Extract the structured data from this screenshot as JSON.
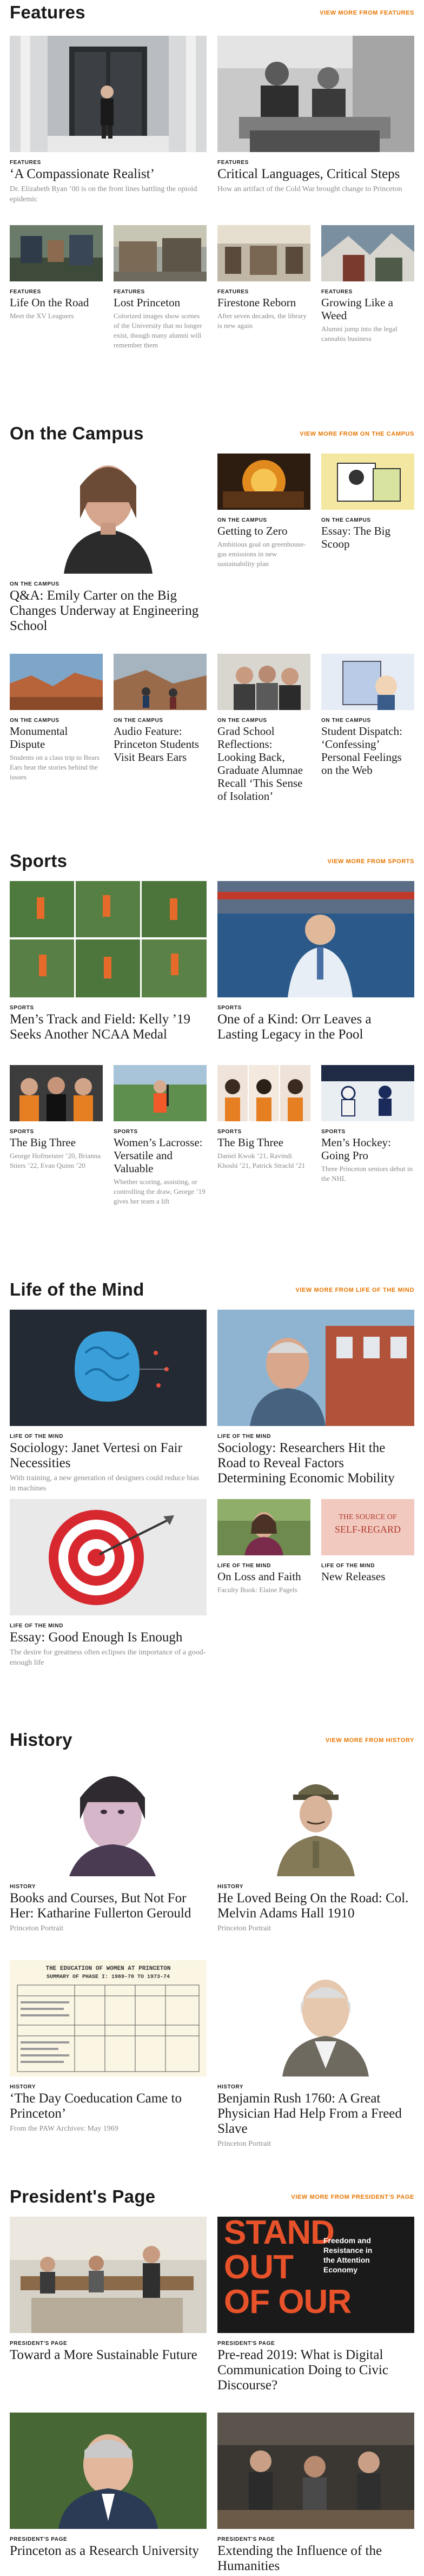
{
  "features": {
    "title": "Features",
    "view_more": "VIEW MORE FROM FEATURES",
    "cards": [
      {
        "kicker": "FEATURES",
        "title": "‘A Compassionate Realist’",
        "dek": "Dr. Elizabeth Ryan ’00 is on the front lines battling the opioid epidemic"
      },
      {
        "kicker": "FEATURES",
        "title": "Critical Languages, Critical Steps",
        "dek": "How an artifact of the Cold War brought change to Princeton"
      },
      {
        "kicker": "FEATURES",
        "title": "Life On the Road",
        "dek": "Meet the XV Leaguers"
      },
      {
        "kicker": "FEATURES",
        "title": "Lost Princeton",
        "dek": "Colorized images show scenes of the University that no longer exist, though many alumni will remember them"
      },
      {
        "kicker": "FEATURES",
        "title": "Firestone Reborn",
        "dek": "After seven decades, the library is new again"
      },
      {
        "kicker": "FEATURES",
        "title": "Growing Like a Weed",
        "dek": "Alumni jump into the legal cannabis business"
      }
    ]
  },
  "campus": {
    "title": "On the Campus",
    "view_more": "VIEW MORE FROM ON THE CAMPUS",
    "cards": [
      {
        "kicker": "ON THE CAMPUS",
        "title": "Q&A: Emily Carter on the Big Changes Underway at Engineering School",
        "dek": ""
      },
      {
        "kicker": "ON THE CAMPUS",
        "title": "Getting to Zero",
        "dek": "Ambitious goal on greenhouse-gas emissions in new sustainability plan"
      },
      {
        "kicker": "ON THE CAMPUS",
        "title": "Essay: The Big Scoop",
        "dek": ""
      },
      {
        "kicker": "ON THE CAMPUS",
        "title": "Monumental Dispute",
        "dek": "Students on a class trip to Bears Ears hear the stories behind the issues"
      },
      {
        "kicker": "ON THE CAMPUS",
        "title": "Audio Feature: Princeton Students Visit Bears Ears",
        "dek": ""
      },
      {
        "kicker": "ON THE CAMPUS",
        "title": "Grad School Reflections: Looking Back, Graduate Alumnae Recall ‘This Sense of Isolation’",
        "dek": ""
      },
      {
        "kicker": "ON THE CAMPUS",
        "title": "Student Dispatch: ‘Confessing’ Personal Feelings on the Web",
        "dek": ""
      }
    ]
  },
  "sports": {
    "title": "Sports",
    "view_more": "VIEW MORE FROM SPORTS",
    "cards": [
      {
        "kicker": "SPORTS",
        "title": "Men’s Track and Field: Kelly ’19 Seeks Another NCAA Medal",
        "dek": ""
      },
      {
        "kicker": "SPORTS",
        "title": "One of a Kind: Orr Leaves a Lasting Legacy in the Pool",
        "dek": ""
      },
      {
        "kicker": "SPORTS",
        "title": "The Big Three",
        "dek": "George Hofmeister ’20, Brianna Stiers ’22, Evan Quinn ’20"
      },
      {
        "kicker": "SPORTS",
        "title": "Women’s Lacrosse: Versatile and Valuable",
        "dek": "Whether scoring, assisting, or controlling the draw, George ’19 gives her team a lift"
      },
      {
        "kicker": "SPORTS",
        "title": "The Big Three",
        "dek": "Daniel Kwok ’21, Ravindi Khoshi ’21, Patrick Strachl ’21"
      },
      {
        "kicker": "SPORTS",
        "title": "Men’s Hockey: Going Pro",
        "dek": "Three Princeton seniors debut in the NHL"
      }
    ]
  },
  "mind": {
    "title": "Life of the Mind",
    "view_more": "VIEW MORE FROM LIFE OF THE MIND",
    "cards": [
      {
        "kicker": "LIFE OF THE MIND",
        "title": "Sociology: Janet Vertesi on Fair Necessities",
        "dek": "With training, a new generation of designers could reduce bias in machines"
      },
      {
        "kicker": "LIFE OF THE MIND",
        "title": "Sociology: Researchers Hit the Road to Reveal Factors Determining Economic Mobility",
        "dek": ""
      },
      {
        "kicker": "LIFE OF THE MIND",
        "title": "Essay: Good Enough Is Enough",
        "dek": "The desire for greatness often eclipses the importance of a good-enough life"
      },
      {
        "kicker": "LIFE OF THE MIND",
        "title": "On Loss and Faith",
        "dek": "Faculty Book: Elaine Pagels"
      },
      {
        "kicker": "LIFE OF THE MIND",
        "title": "New Releases",
        "dek": ""
      }
    ],
    "book_cover_text": [
      "THE SOURCE OF",
      "SELF-REGARD"
    ]
  },
  "history": {
    "title": "History",
    "view_more": "VIEW MORE FROM HISTORY",
    "cards": [
      {
        "kicker": "HISTORY",
        "title": "Books and Courses, But Not For Her: Katharine Fullerton Gerould",
        "dek": "Princeton Portrait"
      },
      {
        "kicker": "HISTORY",
        "title": "He Loved Being On the Road: Col. Melvin Adams Hall 1910",
        "dek": "Princeton Portrait"
      },
      {
        "kicker": "HISTORY",
        "title": "‘The Day Coeducation Came to Princeton’",
        "dek": "From the PAW Archives: May 1969"
      },
      {
        "kicker": "HISTORY",
        "title": "Benjamin Rush 1760: A Great Physician Had Help From a Freed Slave",
        "dek": "Princeton Portrait"
      }
    ],
    "doc_heading": [
      "THE EDUCATION OF WOMEN AT PRINCETON",
      "SUMMARY OF PHASE I: 1969-70 TO 1973-74"
    ]
  },
  "president": {
    "title": "President's Page",
    "view_more": "VIEW MORE FROM PRESIDENT'S PAGE",
    "cards": [
      {
        "kicker": "PRESIDENT'S PAGE",
        "title": "Toward a More Sustainable Future",
        "dek": ""
      },
      {
        "kicker": "PRESIDENT'S PAGE",
        "title": "Pre-read 2019: What is Digital Communication Doing to Civic Discourse?",
        "dek": ""
      },
      {
        "kicker": "PRESIDENT'S PAGE",
        "title": "Princeton as a Research University",
        "dek": ""
      },
      {
        "kicker": "PRESIDENT'S PAGE",
        "title": "Extending the Influence of the Humanities",
        "dek": ""
      }
    ],
    "poster_text": [
      "STAND",
      "OUT",
      "OF OUR",
      "Freedom and",
      "Resistance in",
      "the Attention",
      "Economy"
    ]
  },
  "colors": {
    "accent": "#e77500",
    "text": "#1a1a1a",
    "muted": "#8a8a8a"
  }
}
